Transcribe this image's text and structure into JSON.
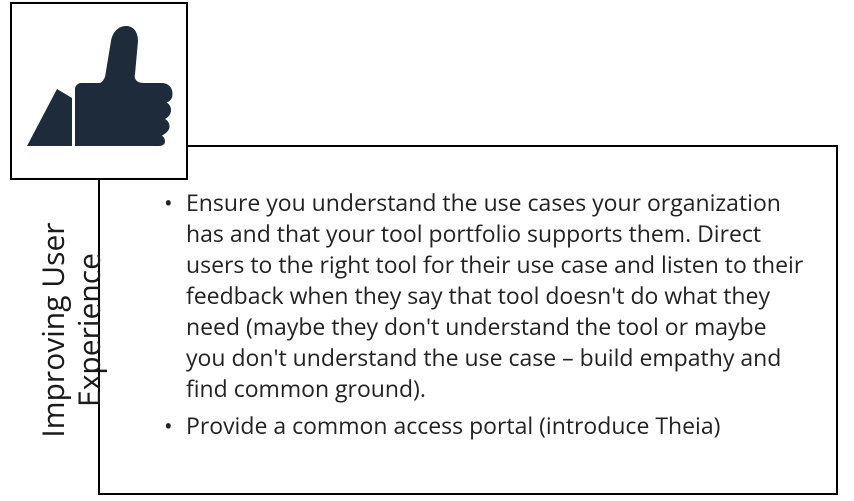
{
  "title": "Improving User Experience",
  "icon": "thumbs-up",
  "bullets": {
    "item0": "Ensure you understand the use cases your organization has and that your tool portfolio supports them.  Direct users to the right tool for their use case and listen to their feedback when they say that tool doesn't do what they need (maybe they don't understand the tool or maybe you don't understand the use case – build empathy and find common ground).",
    "item1": "Provide a common access portal (introduce Theia)"
  }
}
